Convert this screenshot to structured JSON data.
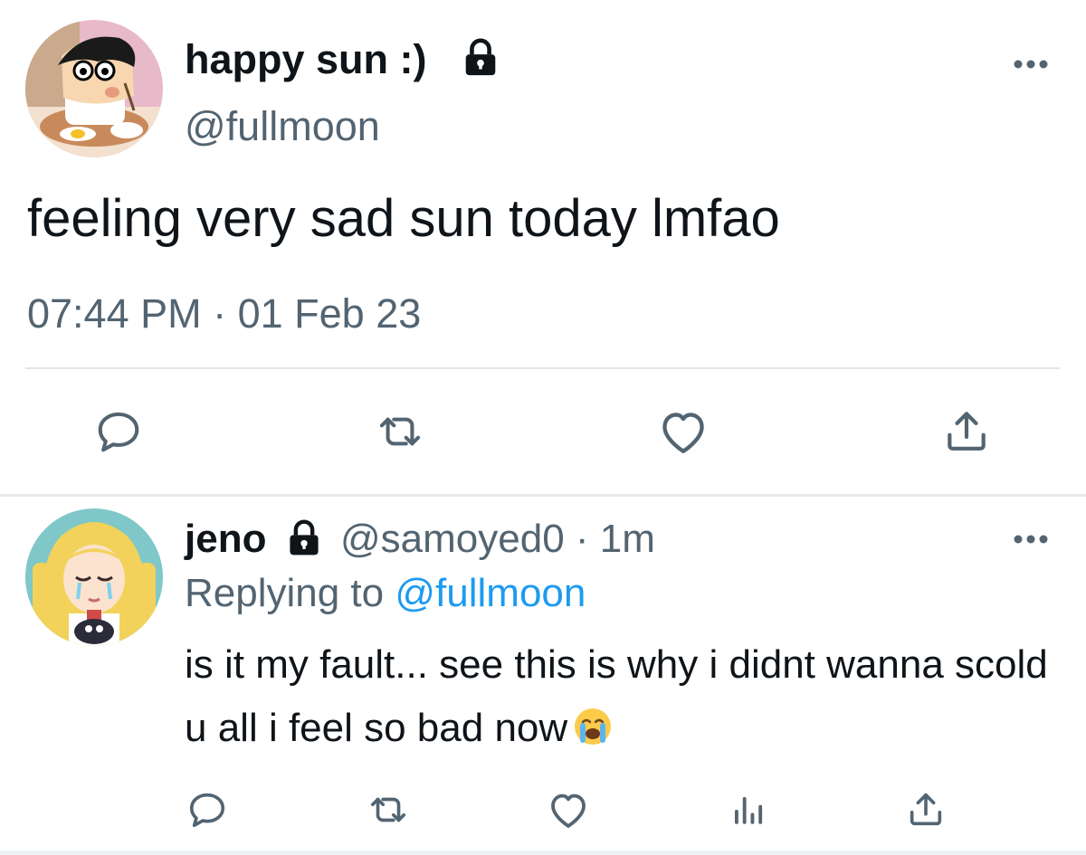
{
  "tweet": {
    "display_name": "happy sun :)",
    "handle": "@fullmoon",
    "text": "feeling very sad sun today lmfao",
    "timestamp": "07:44 PM · 01 Feb 23",
    "protected": true,
    "actions": [
      "reply-icon",
      "retweet-icon",
      "like-icon",
      "share-icon"
    ]
  },
  "reply": {
    "display_name": "jeno",
    "handle": "@samoyed0",
    "separator": "·",
    "time": "1m",
    "protected": true,
    "replying_prefix": "Replying to",
    "replying_to": "@fullmoon",
    "text": "is it my fault... see this is why i didnt wanna scold u all i feel so bad now",
    "emoji": "loudly-crying-face",
    "actions": [
      "reply-icon",
      "retweet-icon",
      "like-icon",
      "analytics-icon",
      "share-icon"
    ]
  },
  "colors": {
    "text": "#0f1419",
    "secondary": "#536471",
    "link": "#1d9bf0",
    "divider": "#e1e6ea"
  }
}
